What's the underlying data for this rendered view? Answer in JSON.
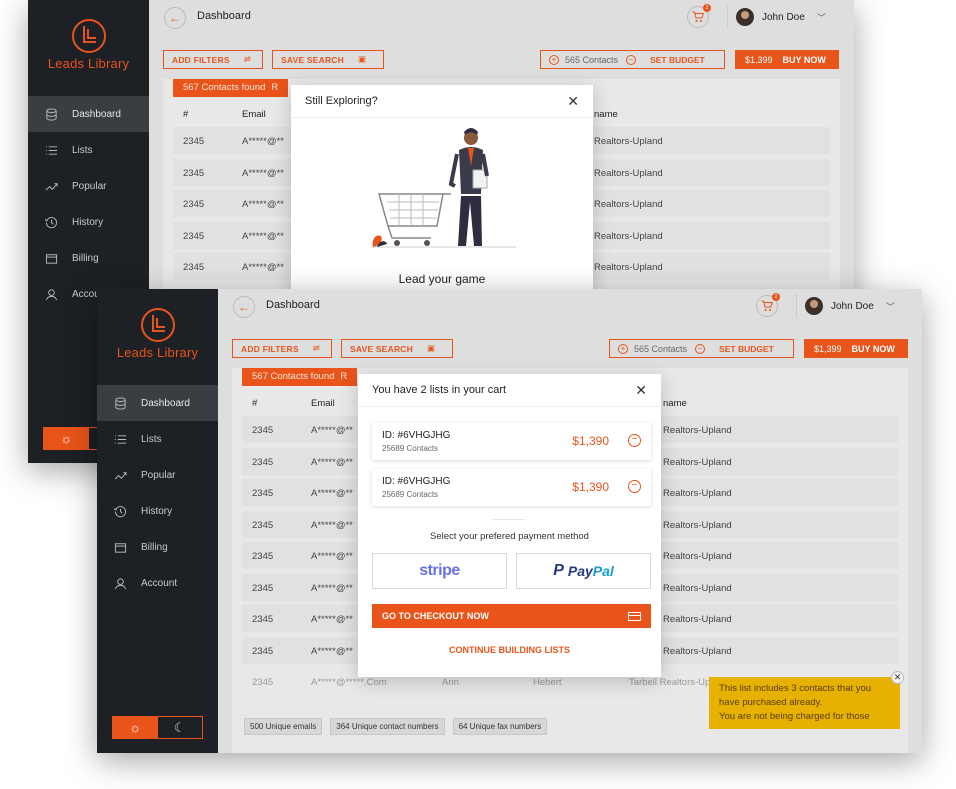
{
  "brand": {
    "name": "Leads Library",
    "accent": "#e8541a",
    "sidebar_bg": "#1d2024"
  },
  "nav": [
    {
      "label": "Dashboard",
      "icon": "database-icon",
      "active": true
    },
    {
      "label": "Lists",
      "icon": "list-icon"
    },
    {
      "label": "Popular",
      "icon": "trending-icon"
    },
    {
      "label": "History",
      "icon": "history-icon"
    },
    {
      "label": "Billing",
      "icon": "wallet-icon"
    },
    {
      "label": "Account",
      "icon": "user-icon"
    }
  ],
  "nav_back_account_partial": "Accou",
  "header": {
    "title": "Dashboard",
    "cart_count": "2",
    "user_name": "John Doe"
  },
  "toolbar": {
    "add_filters": "ADD FILTERS",
    "save_search": "SAVE SEARCH",
    "contacts": "565 Contacts",
    "set_budget": "SET BUDGET",
    "price": "$1,399",
    "buy_now": "BUY NOW"
  },
  "back_window": {
    "found": "567 Contacts found",
    "found_suffix": "R",
    "columns": {
      "num": "#",
      "email": "Email",
      "name": "name"
    },
    "rows": [
      {
        "num": "2345",
        "email": "A*****@**",
        "company": "Realtors-Upland"
      },
      {
        "num": "2345",
        "email": "A*****@**",
        "company": "Realtors-Upland"
      },
      {
        "num": "2345",
        "email": "A*****@**",
        "company": "Realtors-Upland"
      },
      {
        "num": "2345",
        "email": "A*****@**",
        "company": "Realtors-Upland"
      },
      {
        "num": "2345",
        "email": "A*****@**",
        "company": "Realtors-Upland"
      }
    ],
    "modal": {
      "title": "Still Exploring?",
      "lead": "Lead your game"
    }
  },
  "front_window": {
    "found": "567 Contacts found",
    "found_suffix": "R",
    "columns": {
      "num": "#",
      "email": "Email",
      "name": "name"
    },
    "rows": [
      {
        "num": "2345",
        "email": "A*****@**",
        "company": "Realtors-Upland"
      },
      {
        "num": "2345",
        "email": "A*****@**",
        "company": "Realtors-Upland"
      },
      {
        "num": "2345",
        "email": "A*****@**",
        "company": "Realtors-Upland"
      },
      {
        "num": "2345",
        "email": "A*****@**",
        "company": "Realtors-Upland"
      },
      {
        "num": "2345",
        "email": "A*****@**",
        "company": "Realtors-Upland"
      },
      {
        "num": "2345",
        "email": "A*****@**",
        "company": "Realtors-Upland"
      },
      {
        "num": "2345",
        "email": "A*****@**",
        "company": "Realtors-Upland"
      },
      {
        "num": "2345",
        "email": "A*****@**",
        "company": "Realtors-Upland"
      }
    ],
    "last_row": {
      "num": "2345",
      "email": "A*****@*****.Com",
      "first": "Ann",
      "last": "Hebert",
      "company": "Tarbell Realtors-Upland"
    },
    "stats": [
      "500 Unique emails",
      "364 Unique contact numbers",
      "64 Unique fax numbers"
    ],
    "cart_modal": {
      "title": "You have 2 lists in your cart",
      "items": [
        {
          "id": "ID: #6VHGJHG",
          "contacts": "25689 Contacts",
          "price": "$1,390"
        },
        {
          "id": "ID: #6VHGJHG",
          "contacts": "25689 Contacts",
          "price": "$1,390"
        }
      ],
      "payment_label": "Select your prefered payment method",
      "stripe": "stripe",
      "paypal_pay": "Pay",
      "paypal_pal": "Pal",
      "checkout": "GO TO CHECKOUT NOW",
      "continue": "CONTINUE BUILDING LISTS"
    }
  },
  "toast": {
    "line1": "This list includes 3 contacts that you",
    "line2": "have purchased already.",
    "line3": "You are not being charged for those",
    "bg": "#e6b100"
  }
}
